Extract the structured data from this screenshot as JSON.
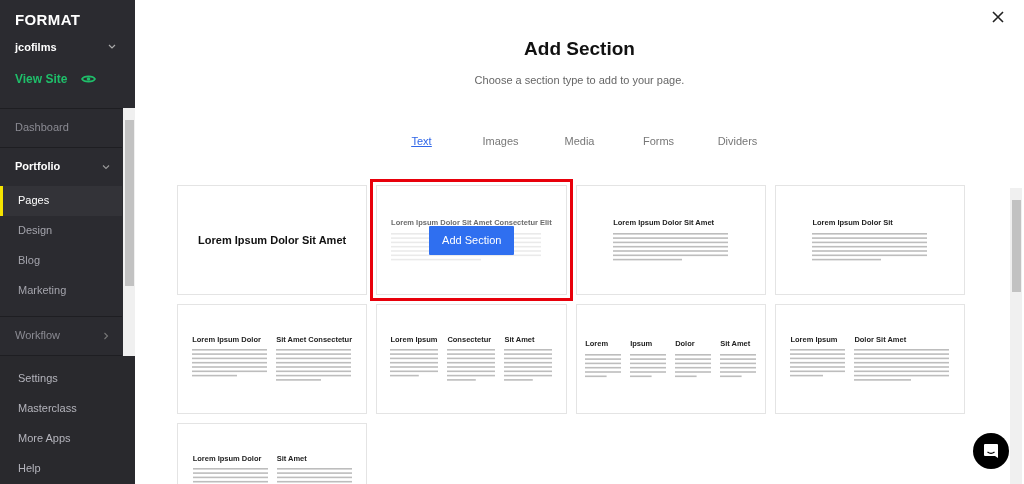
{
  "sidebar": {
    "logo": "FORMAT",
    "account": "jcofilms",
    "view_site": "View Site",
    "nav": [
      {
        "kind": "link",
        "label": "Dashboard"
      },
      {
        "kind": "group",
        "label": "Portfolio",
        "expanded": true,
        "children": [
          {
            "label": "Pages",
            "selected": true
          },
          {
            "label": "Design",
            "selected": false
          },
          {
            "label": "Blog",
            "selected": false
          },
          {
            "label": "Marketing",
            "selected": false
          }
        ]
      },
      {
        "kind": "group",
        "label": "Workflow",
        "expanded": false
      }
    ],
    "footer": [
      "Settings",
      "Masterclass",
      "More Apps",
      "Help"
    ]
  },
  "dialog": {
    "title": "Add Section",
    "subtitle": "Choose a section type to add to your page.",
    "tabs": [
      {
        "label": "Text",
        "selected": true
      },
      {
        "label": "Images",
        "selected": false
      },
      {
        "label": "Media",
        "selected": false
      },
      {
        "label": "Forms",
        "selected": false
      },
      {
        "label": "Dividers",
        "selected": false
      }
    ],
    "cards": [
      {
        "kind": "title",
        "headings": [
          "Lorem Ipsum Dolor Sit Amet"
        ],
        "hovered": false
      },
      {
        "kind": "columns",
        "headings": [
          "Lorem Ipsum Dolor Sit Amet Consectetur Elit"
        ],
        "hovered": true,
        "button": "Add Section"
      },
      {
        "kind": "columns",
        "headings": [
          "Lorem Ipsum Dolor Sit Amet"
        ],
        "hovered": false
      },
      {
        "kind": "columns",
        "headings": [
          "Lorem Ipsum Dolor Sit"
        ],
        "hovered": false
      },
      {
        "kind": "columns",
        "headings": [
          "Lorem Ipsum Dolor",
          "Sit Amet Consectetur"
        ],
        "hovered": false
      },
      {
        "kind": "columns",
        "headings": [
          "Lorem Ipsum",
          "Consectetur",
          "Sit Amet"
        ],
        "hovered": false
      },
      {
        "kind": "columns",
        "headings": [
          "Lorem",
          "Ipsum",
          "Dolor",
          "Sit Amet"
        ],
        "hovered": false
      },
      {
        "kind": "columns",
        "headings": [
          "Lorem Ipsum",
          "Dolor Sit Amet"
        ],
        "hovered": false
      },
      {
        "kind": "columns",
        "headings": [
          "Lorem Ipsum Dolor",
          "Sit Amet"
        ],
        "hovered": false
      }
    ]
  }
}
